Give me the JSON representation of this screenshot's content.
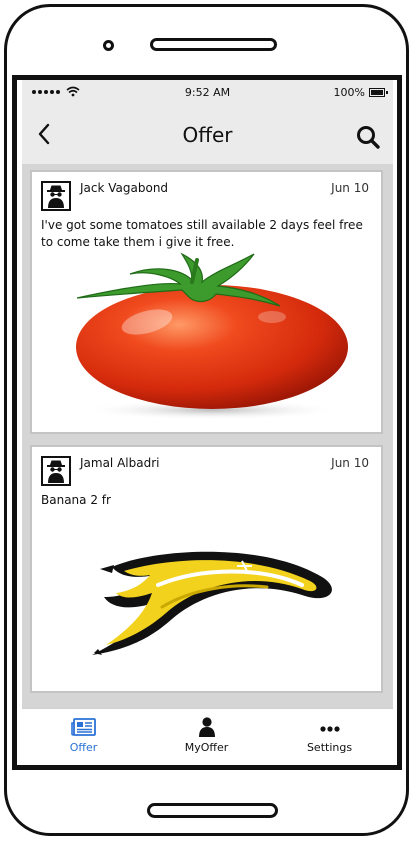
{
  "status_bar": {
    "time": "9:52 AM",
    "battery": "100%"
  },
  "header": {
    "title": "Offer"
  },
  "posts": [
    {
      "author": "Jack Vagabond",
      "date": "Jun 10",
      "text": "I've got some tomatoes still available 2 days feel free to come take them i give it free.",
      "image": "tomato"
    },
    {
      "author": "Jamal Albadri",
      "date": "Jun 10",
      "text": "Banana 2 fr",
      "image": "banana"
    }
  ],
  "tabbar": {
    "items": [
      {
        "label": "Offer",
        "icon": "newspaper-icon",
        "active": true
      },
      {
        "label": "MyOffer",
        "icon": "user-icon",
        "active": false
      },
      {
        "label": "Settings",
        "icon": "more-icon",
        "active": false
      }
    ]
  },
  "colors": {
    "accent": "#2a72d6",
    "header_bg": "#ebebeb",
    "feed_bg": "#d5d5d5"
  }
}
